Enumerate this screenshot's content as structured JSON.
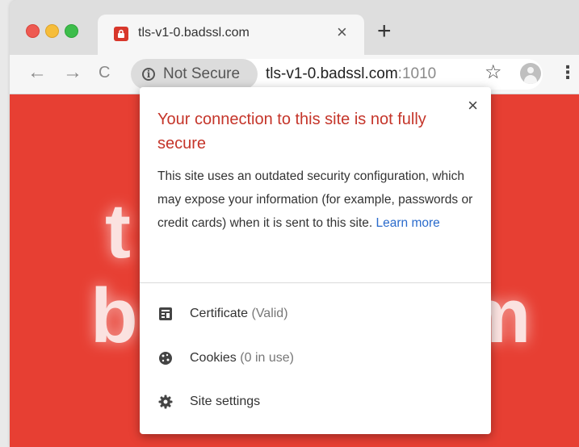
{
  "tab": {
    "title": "tls-v1-0.badssl.com",
    "close_glyph": "×"
  },
  "tabstrip": {
    "new_tab_glyph": "+"
  },
  "toolbar": {
    "back_glyph": "←",
    "forward_glyph": "→",
    "reload_glyph": "C",
    "security_label": "Not Secure",
    "url_host": "tls-v1-0.badssl.com",
    "url_port": ":1010",
    "star_glyph": "☆",
    "menu_glyph": "⋮"
  },
  "page": {
    "letter_t": "t",
    "letter_b": "b",
    "letter_m": "m"
  },
  "popup": {
    "close_glyph": "×",
    "title": "Your connection to this site is not fully secure",
    "body": "This site uses an outdated security configuration, which may expose your information (for example, passwords or credit cards) when it is sent to this site.",
    "learn_more": "Learn more",
    "rows": [
      {
        "label": "Certificate",
        "detail": "(Valid)",
        "icon": "certificate-icon"
      },
      {
        "label": "Cookies",
        "detail": "(0 in use)",
        "icon": "cookie-icon"
      },
      {
        "label": "Site settings",
        "detail": "",
        "icon": "gear-icon"
      }
    ]
  },
  "colors": {
    "page_background": "#e73f33",
    "warning_title": "#c5352a",
    "link": "#2a6bcc"
  }
}
